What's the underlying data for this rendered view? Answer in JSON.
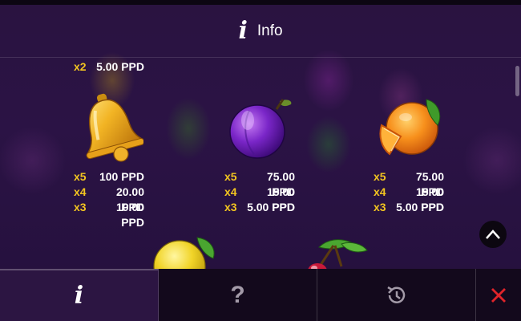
{
  "header": {
    "title": "Info",
    "icon": "info-icon"
  },
  "paytable": {
    "top_row": {
      "multiplier": "x2",
      "amount": "5.00 PPD"
    },
    "symbols": [
      {
        "name": "bell",
        "payouts": [
          {
            "multiplier": "x5",
            "amount": "100 PPD"
          },
          {
            "multiplier": "x4",
            "amount": "20.00 PPD"
          },
          {
            "multiplier": "x3",
            "amount": "10.00 PPD"
          }
        ]
      },
      {
        "name": "plum",
        "payouts": [
          {
            "multiplier": "x5",
            "amount": "75.00 PPD"
          },
          {
            "multiplier": "x4",
            "amount": "15.00 PPD"
          },
          {
            "multiplier": "x3",
            "amount": "5.00 PPD"
          }
        ]
      },
      {
        "name": "orange",
        "payouts": [
          {
            "multiplier": "x5",
            "amount": "75.00 PPD"
          },
          {
            "multiplier": "x4",
            "amount": "15.00 PPD"
          },
          {
            "multiplier": "x3",
            "amount": "5.00 PPD"
          }
        ]
      }
    ],
    "partially_visible": [
      "lemon",
      "cherries"
    ]
  },
  "bottom_bar": {
    "tabs": [
      {
        "icon": "info-icon",
        "active": true
      },
      {
        "icon": "question-icon",
        "active": false
      },
      {
        "icon": "history-icon",
        "active": false
      },
      {
        "icon": "close-icon",
        "active": false
      }
    ]
  },
  "colors": {
    "multiplier": "#f3c520",
    "amount": "#ffffff",
    "close": "#e0242a",
    "background": "#24103c"
  }
}
